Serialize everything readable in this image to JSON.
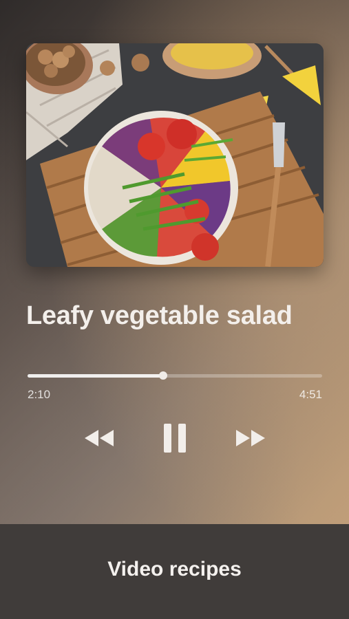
{
  "player": {
    "title": "Leafy vegetable salad",
    "elapsed": "2:10",
    "total": "4:51",
    "progress": 0.461
  },
  "controls": {
    "rewind_icon": "rewind-icon",
    "pause_icon": "pause-icon",
    "forward_icon": "fast-forward-icon"
  },
  "artwork": {
    "image": "salad bowl on wooden board with walnuts, lemon and fork"
  },
  "bottom_bar": {
    "label": "Video recipes"
  },
  "colors": {
    "accent": "#f0ece8",
    "bar_background": "#403c3a"
  }
}
